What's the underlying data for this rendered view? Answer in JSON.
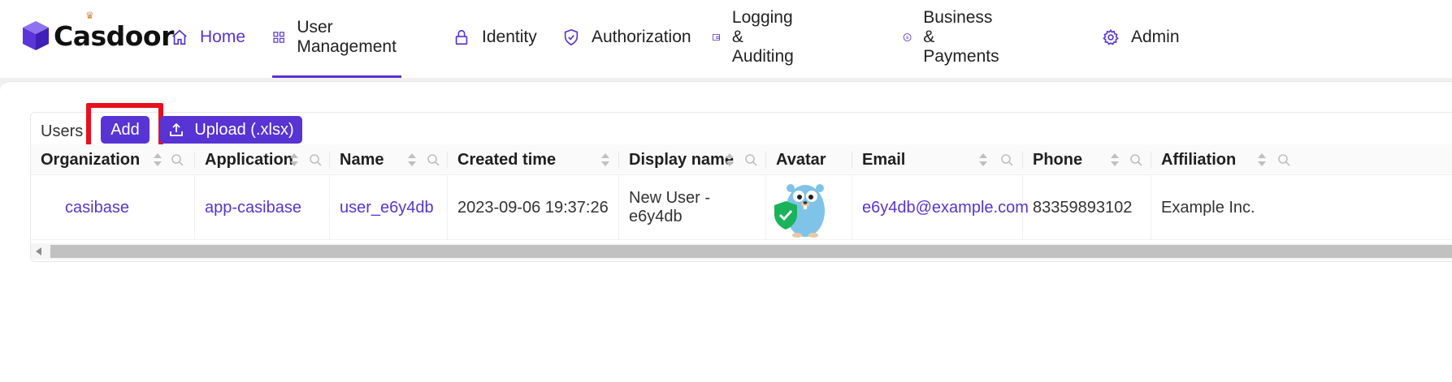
{
  "app": {
    "logo_text": "Casdoor",
    "accent_color": "#5734d3",
    "alert_color": "#e8101e"
  },
  "nav": {
    "items": [
      {
        "label": "Home",
        "icon": "home-icon"
      },
      {
        "label": "User Management",
        "icon": "apps-grid-icon"
      },
      {
        "label": "Identity",
        "icon": "lock-icon"
      },
      {
        "label": "Authorization",
        "icon": "shield-check-icon"
      },
      {
        "label": "Logging & Auditing",
        "icon": "wallet-icon"
      },
      {
        "label": "Business & Payments",
        "icon": "dollar-circle-icon"
      },
      {
        "label": "Admin",
        "icon": "gear-icon"
      }
    ],
    "selected": "Home",
    "underlined": "User Management"
  },
  "table": {
    "title": "Users",
    "add_label": "Add",
    "upload_label": "Upload (.xlsx)",
    "columns": [
      "Organization",
      "Application",
      "Name",
      "Created time",
      "Display name",
      "Avatar",
      "Email",
      "Phone",
      "Affiliation"
    ],
    "rows": [
      {
        "organization": "casibase",
        "application": "app-casibase",
        "name": "user_e6y4db",
        "created_time": "2023-09-06 19:37:26",
        "display_name": "New User - e6y4db",
        "avatar": "gopher-shield-avatar",
        "email": "e6y4db@example.com",
        "phone": "83359893102",
        "affiliation": "Example Inc."
      }
    ]
  }
}
